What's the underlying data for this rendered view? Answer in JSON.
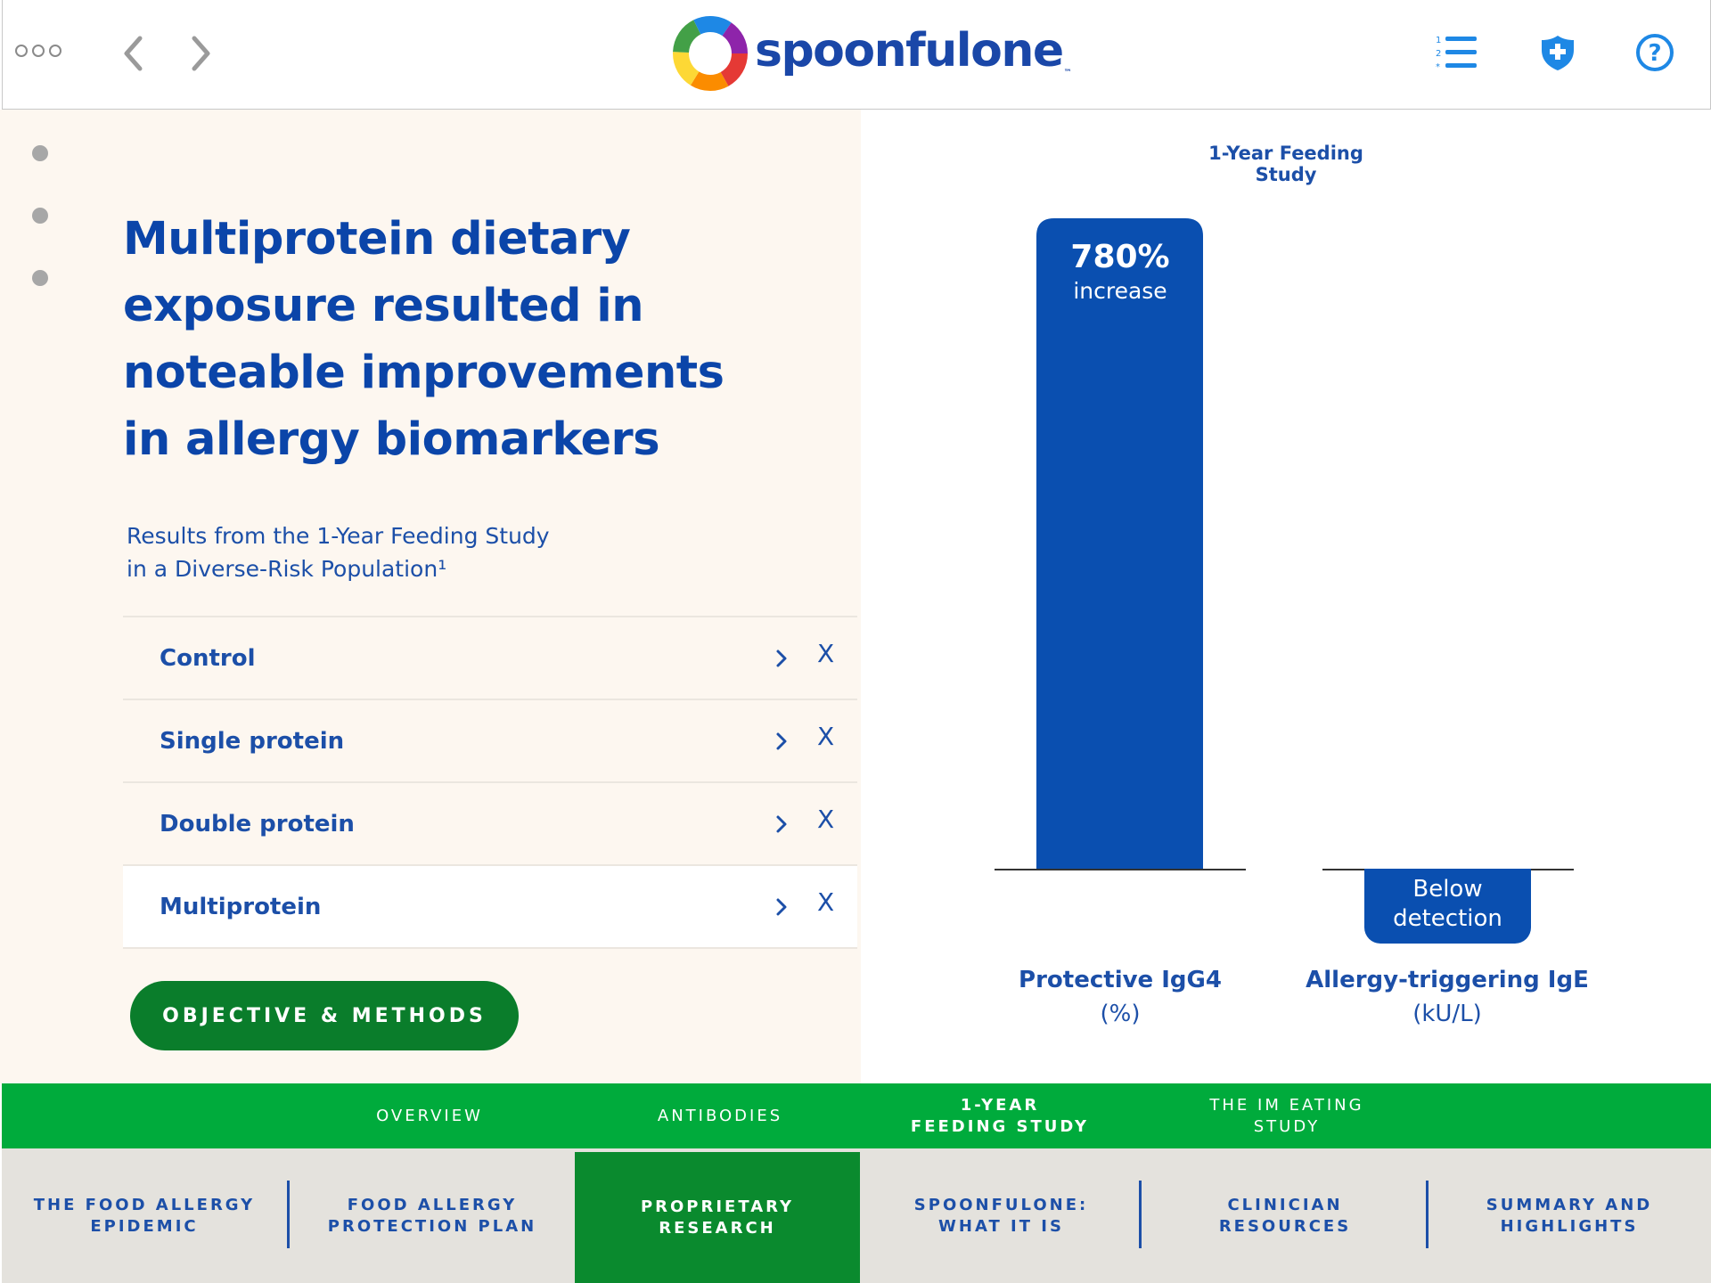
{
  "header": {
    "logo_text": "spoonfulone",
    "logo_tm": "™",
    "icons": [
      "more-dots-icon",
      "back-arrow-icon",
      "forward-arrow-icon",
      "numbered-list-icon",
      "shield-plus-icon",
      "help-circle-icon"
    ]
  },
  "left": {
    "headline": "Multiprotein dietary exposure resulted in noteable improvements in allergy biomarkers",
    "subhead_line1": "Results from the 1-Year Feeding Study",
    "subhead_line2": "in a Diverse-Risk Population¹",
    "groups": [
      {
        "label": "Control",
        "close": "X"
      },
      {
        "label": "Single protein",
        "close": "X"
      },
      {
        "label": "Double protein",
        "close": "X"
      },
      {
        "label": "Multiprotein",
        "close": "X"
      }
    ],
    "active_group": "Multiprotein",
    "objective_button": "OBJECTIVE & METHODS"
  },
  "chart_data": {
    "type": "bar",
    "title": "1-Year Feeding Study",
    "categories": [
      "Protective IgG4",
      "Allergy-triggering IgE"
    ],
    "units": [
      "(%)",
      "(kU/L)"
    ],
    "series": [
      {
        "values": [
          780,
          0
        ]
      }
    ],
    "annotations": {
      "bar1_value": "780%",
      "bar1_desc": "increase",
      "bar2_line1": "Below",
      "bar2_line2": "detection"
    },
    "colors": {
      "bar": "#0a4fb0",
      "baseline": "#333333"
    }
  },
  "subnav": {
    "items": [
      {
        "line1": "OVERVIEW",
        "line2": ""
      },
      {
        "line1": "ANTIBODIES",
        "line2": ""
      },
      {
        "line1": "1-YEAR",
        "line2": "FEEDING STUDY"
      },
      {
        "line1": "THE IM EATING",
        "line2": "STUDY"
      }
    ],
    "active": "1-YEAR FEEDING STUDY"
  },
  "mainnav": {
    "items": [
      {
        "line1": "THE FOOD ALLERGY",
        "line2": "EPIDEMIC"
      },
      {
        "line1": "FOOD ALLERGY",
        "line2": "PROTECTION PLAN"
      },
      {
        "line1": "PROPRIETARY",
        "line2": "RESEARCH"
      },
      {
        "line1": "SPOONFULONE:",
        "line2": "WHAT IT IS"
      },
      {
        "line1": "CLINICIAN",
        "line2": "RESOURCES"
      },
      {
        "line1": "SUMMARY AND",
        "line2": "HIGHLIGHTS"
      }
    ],
    "active": "PROPRIETARY RESEARCH"
  },
  "colors": {
    "brand_blue": "#1c4fa8",
    "bar_blue": "#0a4fb0",
    "green": "#00ab3c",
    "dark_green": "#0a8a2e",
    "panel_bg": "#fdf7f0"
  }
}
